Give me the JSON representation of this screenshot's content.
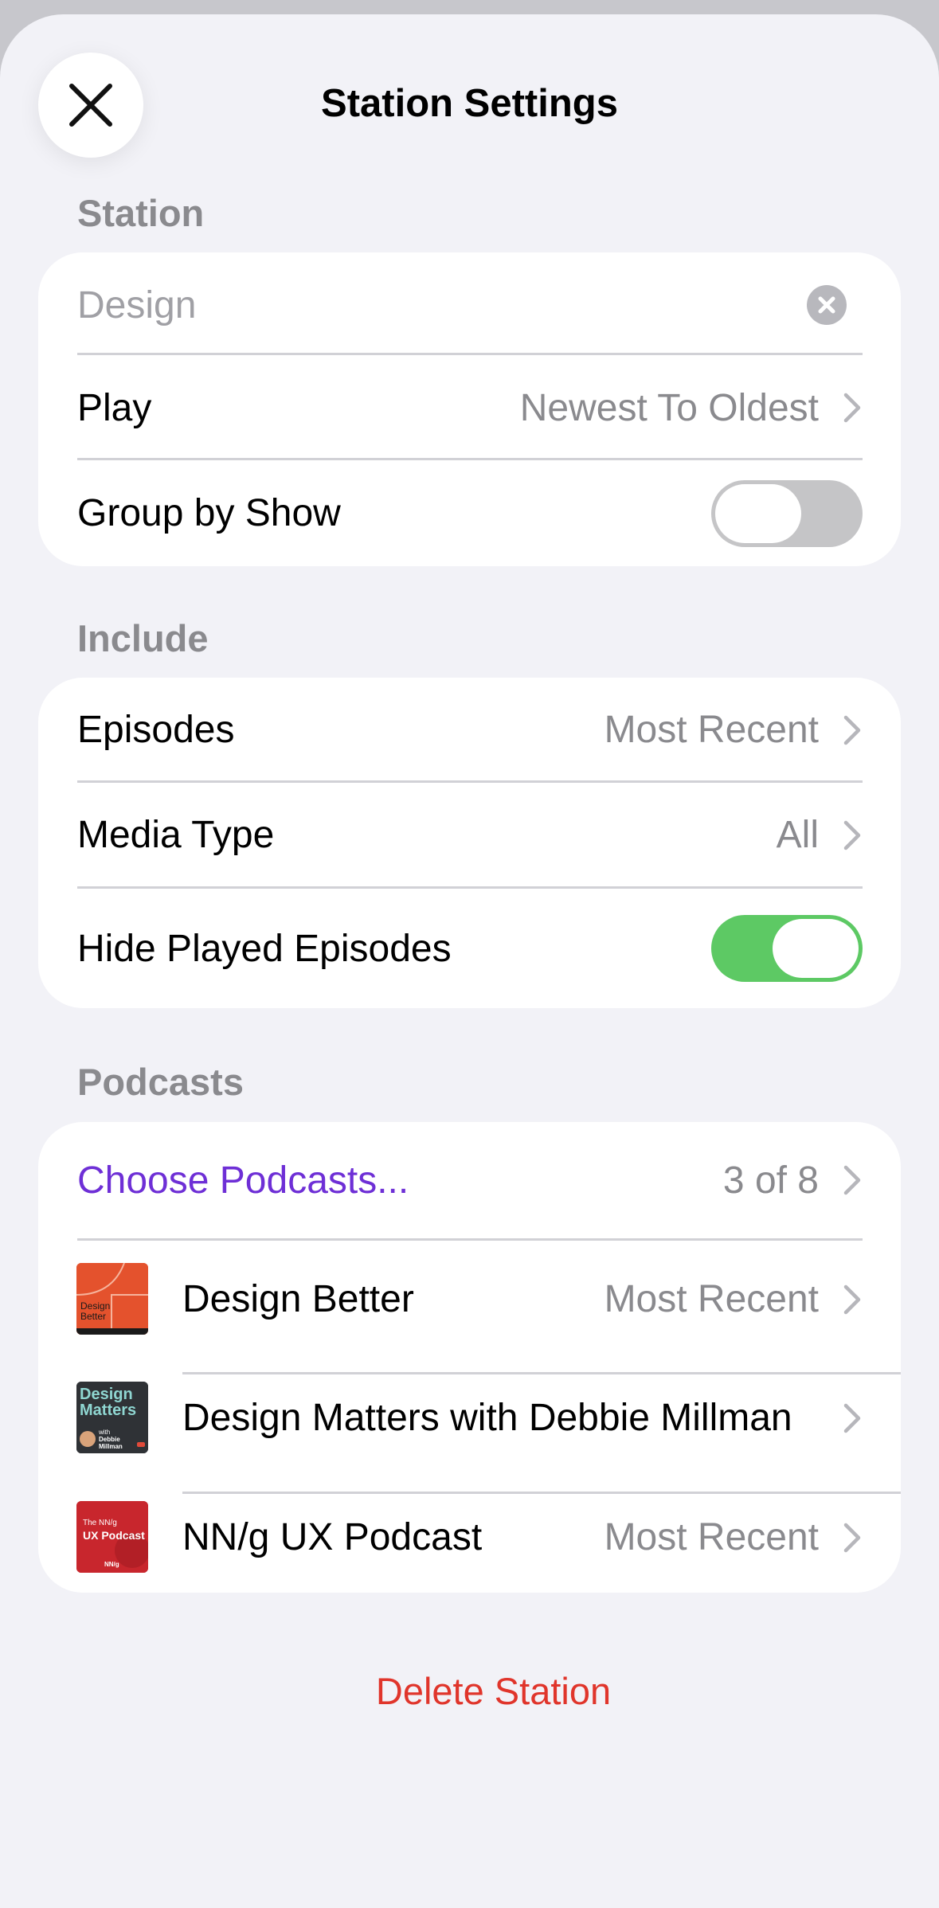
{
  "header": {
    "title": "Station Settings"
  },
  "station": {
    "header": "Station",
    "name_placeholder": "Design",
    "play_label": "Play",
    "play_value": "Newest To Oldest",
    "group_label": "Group by Show",
    "group_on": false
  },
  "include": {
    "header": "Include",
    "episodes_label": "Episodes",
    "episodes_value": "Most Recent",
    "media_label": "Media Type",
    "media_value": "All",
    "hide_label": "Hide Played Episodes",
    "hide_on": true
  },
  "podcasts": {
    "header": "Podcasts",
    "choose_label": "Choose Podcasts...",
    "choose_value": "3 of 8",
    "items": [
      {
        "title": "Design Better",
        "value": "Most Recent",
        "art_text": "Design Better"
      },
      {
        "title": "Design Matters with Debbie Millman",
        "value": "",
        "art_text": "Design Matters"
      },
      {
        "title": "NN/g UX Podcast",
        "value": "Most Recent",
        "art_text": "UX Podcast"
      }
    ]
  },
  "footer": {
    "delete_label": "Delete Station"
  },
  "colors": {
    "accent_purple": "#6e2fd6",
    "toggle_on": "#5dc964",
    "toggle_off": "#c5c5c7",
    "destructive": "#e0352b"
  }
}
